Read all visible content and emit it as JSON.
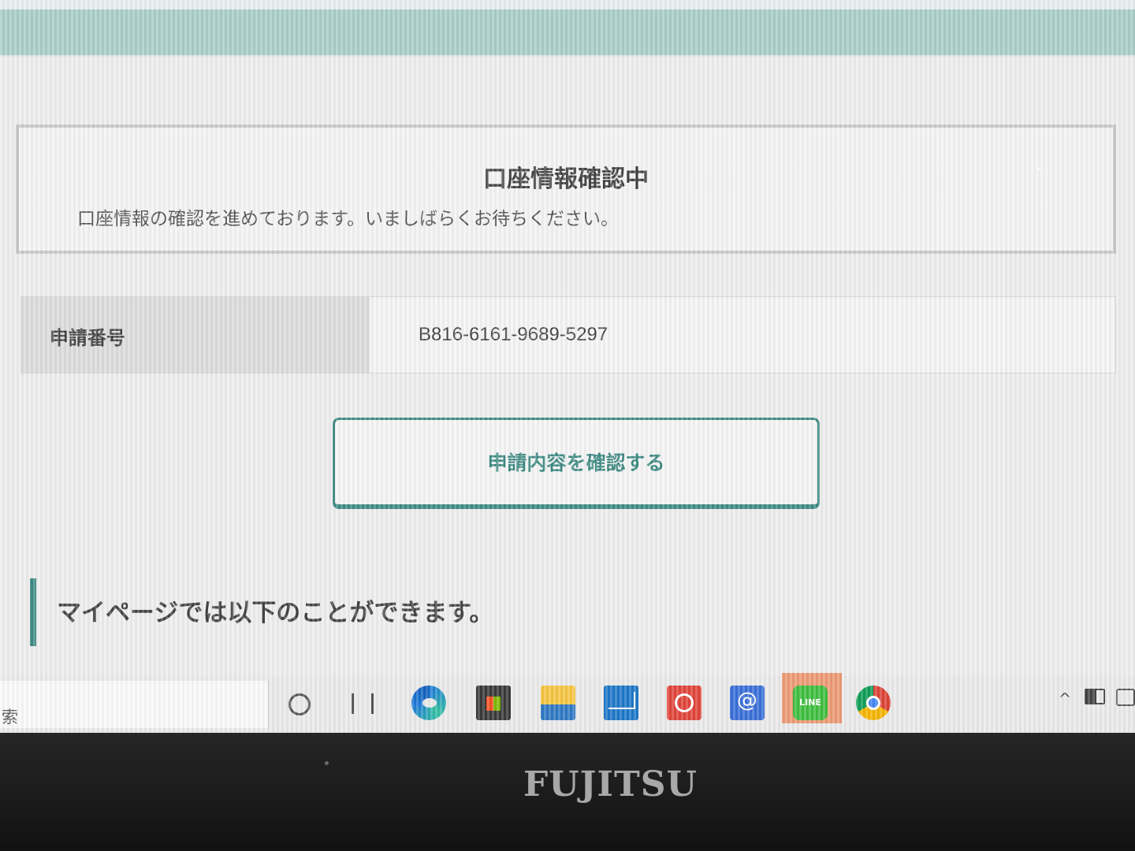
{
  "status": {
    "title": "口座情報確認中",
    "message": "口座情報の確認を進めております。いましばらくお待ちください。"
  },
  "application": {
    "label": "申請番号",
    "value": "B816-6161-9689-5297"
  },
  "confirm_button": {
    "label": "申請内容を確認する"
  },
  "mypage": {
    "heading": "マイページでは以下のことができます。"
  },
  "taskbar": {
    "search_text": "索",
    "icons": [
      "cortana-icon",
      "task-view-icon",
      "edge-icon",
      "store-icon",
      "file-explorer-icon",
      "mail-icon",
      "media-icon",
      "at-menu-icon",
      "line-icon",
      "chrome-icon"
    ],
    "at_menu_glyph": "@",
    "line_label": "LINE"
  },
  "bezel": {
    "brand": "FUJITSU"
  },
  "colors": {
    "accent": "#3f8b84",
    "header_band": "#a9cdc8"
  }
}
